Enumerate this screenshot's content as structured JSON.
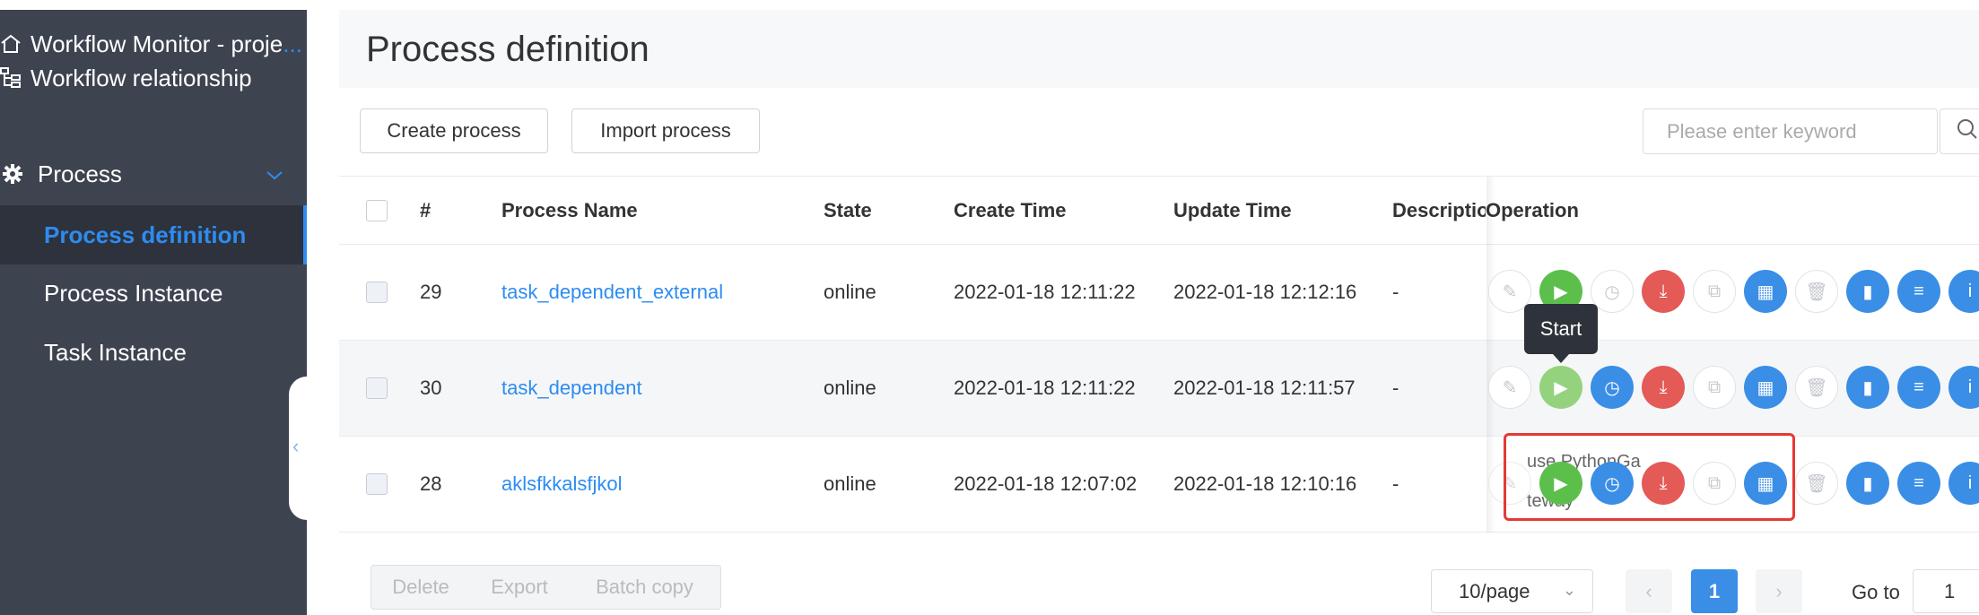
{
  "sidebar": {
    "items": [
      {
        "label": "Workflow Monitor - proje",
        "icon": "home-icon",
        "trail": "..."
      },
      {
        "label": "Workflow relationship",
        "icon": "tree-icon"
      },
      {
        "label": "Process",
        "icon": "gear-icon"
      }
    ],
    "sub_items": [
      {
        "label": "Process definition",
        "active": true
      },
      {
        "label": "Process Instance"
      },
      {
        "label": "Task Instance"
      }
    ]
  },
  "header": {
    "title": "Process definition"
  },
  "toolbar": {
    "create_label": "Create process",
    "import_label": "Import process",
    "search_placeholder": "Please enter keyword"
  },
  "table": {
    "columns": [
      "#",
      "Process Name",
      "State",
      "Create Time",
      "Update Time",
      "Descriptio",
      "Operation"
    ],
    "rows": [
      {
        "id": "29",
        "name": "task_dependent_external",
        "state": "online",
        "create": "2022-01-18 12:11:22",
        "update": "2022-01-18 12:12:16",
        "desc": "-"
      },
      {
        "id": "30",
        "name": "task_dependent",
        "state": "online",
        "create": "2022-01-18 12:11:22",
        "update": "2022-01-18 12:11:57",
        "desc": "-"
      },
      {
        "id": "28",
        "name": "aklsfkkalsfjkol",
        "state": "online",
        "create": "2022-01-18 12:07:02",
        "update": "2022-01-18 12:10:16",
        "desc": "-"
      }
    ]
  },
  "tooltip": "Start",
  "ghost_text": {
    "line1": "use PythonGa",
    "line2": "teway"
  },
  "footer": {
    "delete_label": "Delete",
    "export_label": "Export",
    "batch_label": "Batch copy",
    "page_size": "10/page",
    "current_page": "1",
    "goto_label": "Go to",
    "goto_value": "1"
  },
  "colors": {
    "accent": "#2d8cf0",
    "sidebar": "#3e4350",
    "start": "#5cbf4c",
    "danger": "#e35a57",
    "highlight": "#e53935"
  }
}
